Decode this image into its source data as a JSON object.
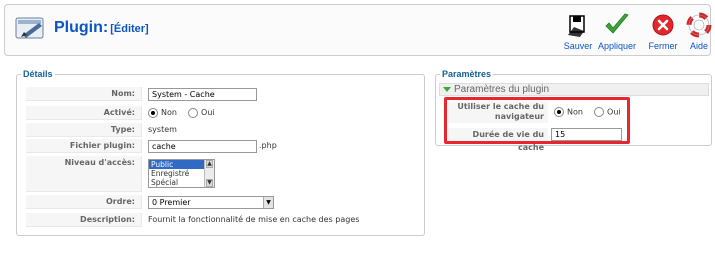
{
  "header": {
    "title": "Plugin:",
    "subtitle": "[Éditer]",
    "buttons": [
      {
        "label": "Sauver",
        "icon": "save-icon"
      },
      {
        "label": "Appliquer",
        "icon": "apply-check-icon"
      },
      {
        "label": "Fermer",
        "icon": "close-icon"
      },
      {
        "label": "Aide",
        "icon": "help-lifebuoy-icon"
      }
    ]
  },
  "details": {
    "legend": "Détails",
    "nom_label": "Nom:",
    "nom_value": "System - Cache",
    "active_label": "Activé:",
    "active_no": "Non",
    "active_yes": "Oui",
    "active_selected": "Non",
    "type_label": "Type:",
    "type_value": "system",
    "file_label": "Fichier plugin:",
    "file_value": "cache",
    "file_ext": ".php",
    "access_label": "Niveau d'accès:",
    "access_options": [
      "Public",
      "Enregistré",
      "Spécial"
    ],
    "access_selected": "Public",
    "order_label": "Ordre:",
    "order_value": "0 Premier",
    "desc_label": "Description:",
    "desc_value": "Fournit la fonctionnalité de mise en cache des pages"
  },
  "params": {
    "legend": "Paramètres",
    "section": "Paramètres du plugin",
    "browser_cache_label": "Utiliser le cache du navigateur",
    "browser_cache_no": "Non",
    "browser_cache_yes": "Oui",
    "browser_cache_selected": "Non",
    "lifetime_label": "Durée de vie du cache",
    "lifetime_value": "15",
    "highlight_color": "#e8262d"
  },
  "colors": {
    "accent": "#0b55c4",
    "legend": "#146295"
  }
}
